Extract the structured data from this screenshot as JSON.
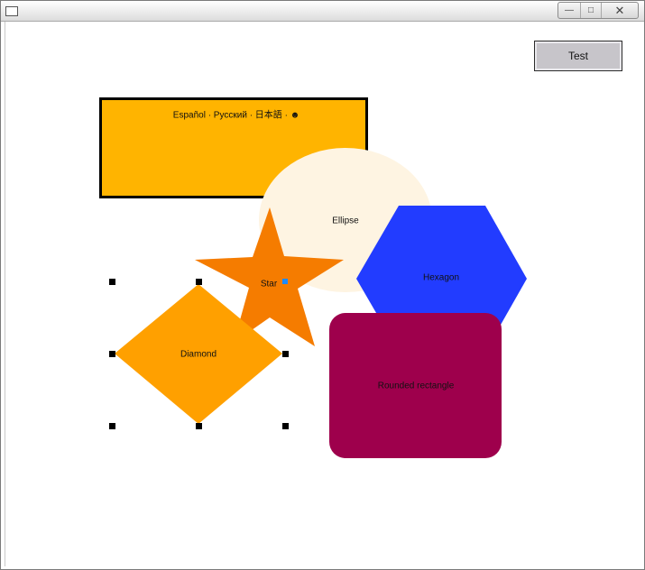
{
  "window": {
    "controls": {
      "minimize": "—",
      "maximize": "□",
      "close": "✕"
    }
  },
  "toolbar": {
    "test_label": "Test"
  },
  "shapes": {
    "rectangle": {
      "label": "Español · Русский · 日本語 · ☻",
      "fill": "#ffb400",
      "stroke": "#000000"
    },
    "ellipse": {
      "label": "Ellipse",
      "fill": "#fef4e2"
    },
    "hexagon": {
      "label": "Hexagon",
      "fill": "#223cff"
    },
    "star": {
      "label": "Star",
      "fill": "#f57c00"
    },
    "rounded_rectangle": {
      "label": "Rounded rectangle",
      "fill": "#9e004c"
    },
    "diamond": {
      "label": "Diamond",
      "fill": "#ffa000",
      "selected": true
    }
  }
}
